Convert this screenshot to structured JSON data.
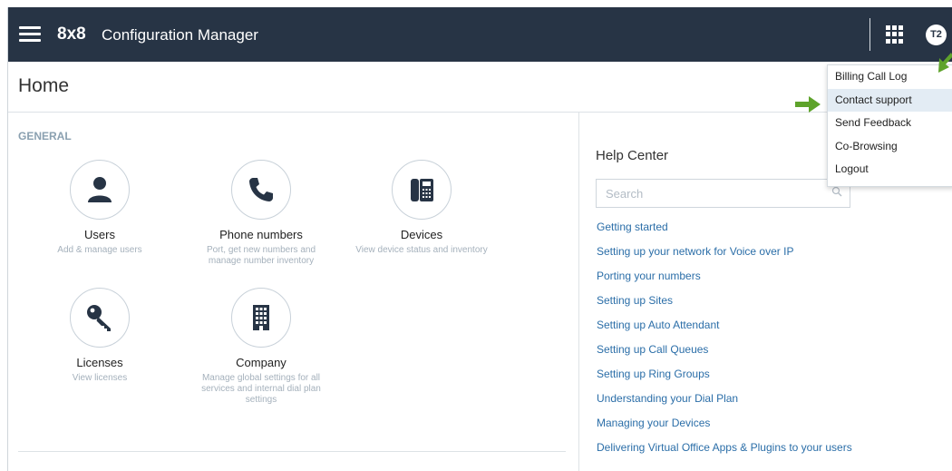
{
  "header": {
    "logo": "8x8",
    "app_title": "Configuration Manager",
    "avatar_initials": "T2",
    "bg_color": "#273445"
  },
  "page": {
    "title": "Home"
  },
  "general": {
    "label": "GENERAL",
    "tiles": [
      {
        "icon": "user-icon",
        "name": "Users",
        "desc": "Add & manage users"
      },
      {
        "icon": "phone-icon",
        "name": "Phone numbers",
        "desc": "Port, get new numbers and manage number inventory"
      },
      {
        "icon": "desk-phone-icon",
        "name": "Devices",
        "desc": "View device status and inventory"
      },
      {
        "icon": "key-icon",
        "name": "Licenses",
        "desc": "View licenses"
      },
      {
        "icon": "building-icon",
        "name": "Company",
        "desc": "Manage global settings for all services and internal dial plan settings"
      }
    ]
  },
  "help_center": {
    "title": "Help Center",
    "search_placeholder": "Search",
    "links": [
      "Getting started",
      "Setting up your network for Voice over IP",
      "Porting your numbers",
      "Setting up Sites",
      "Setting up Auto Attendant",
      "Setting up Call Queues",
      "Setting up Ring Groups",
      "Understanding your Dial Plan",
      "Managing your Devices",
      "Delivering Virtual Office Apps & Plugins to your users"
    ],
    "link_color": "#2b6ea8"
  },
  "user_menu": {
    "items": [
      "Billing Call Log",
      "Contact support",
      "Send Feedback",
      "Co-Browsing",
      "Logout"
    ],
    "highlighted": "Contact support"
  },
  "annotation": {
    "arrow_color": "#5ea32b"
  }
}
